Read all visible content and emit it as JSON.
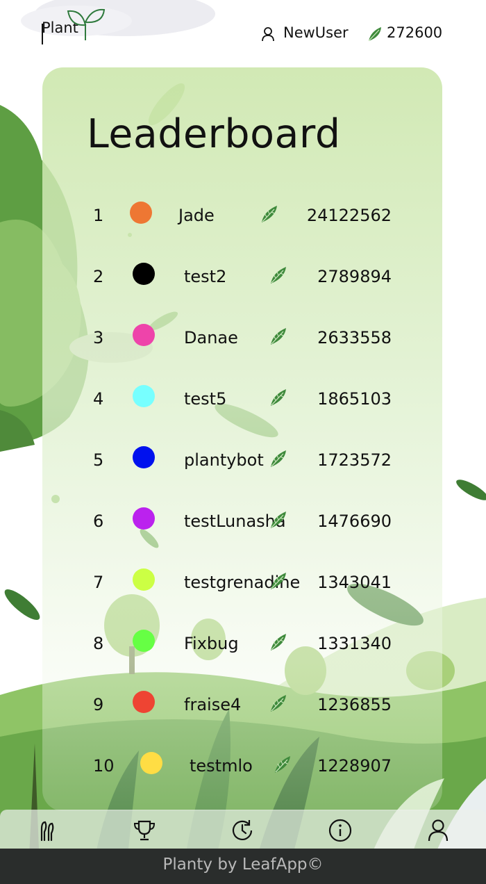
{
  "header": {
    "brand": "Plant",
    "username": "NewUser",
    "points": "272600"
  },
  "title": "Leaderboard",
  "leaderboard": [
    {
      "rank": "1",
      "name": "Jade",
      "score": "24122562",
      "color": "#EE7733"
    },
    {
      "rank": "2",
      "name": "test2",
      "score": "2789894",
      "color": "#000000"
    },
    {
      "rank": "3",
      "name": "Danae",
      "score": "2633558",
      "color": "#EE44AA"
    },
    {
      "rank": "4",
      "name": "test5",
      "score": "1865103",
      "color": "#77FFFF"
    },
    {
      "rank": "5",
      "name": "plantybot",
      "score": "1723572",
      "color": "#0011EE"
    },
    {
      "rank": "6",
      "name": "testLunasha",
      "score": "1476690",
      "color": "#BB22EE"
    },
    {
      "rank": "7",
      "name": "testgrenadine",
      "score": "1343041",
      "color": "#CCFF44"
    },
    {
      "rank": "8",
      "name": "Fixbug",
      "score": "1331340",
      "color": "#66FF44"
    },
    {
      "rank": "9",
      "name": "fraise4",
      "score": "1236855",
      "color": "#EE4433"
    },
    {
      "rank": "10",
      "name": "testmlo",
      "score": "1228907",
      "color": "#FFDD44"
    }
  ],
  "nav": [
    "plants-icon",
    "trophy-icon",
    "history-icon",
    "info-icon",
    "profile-icon"
  ],
  "footer": "Planty by LeafApp©"
}
